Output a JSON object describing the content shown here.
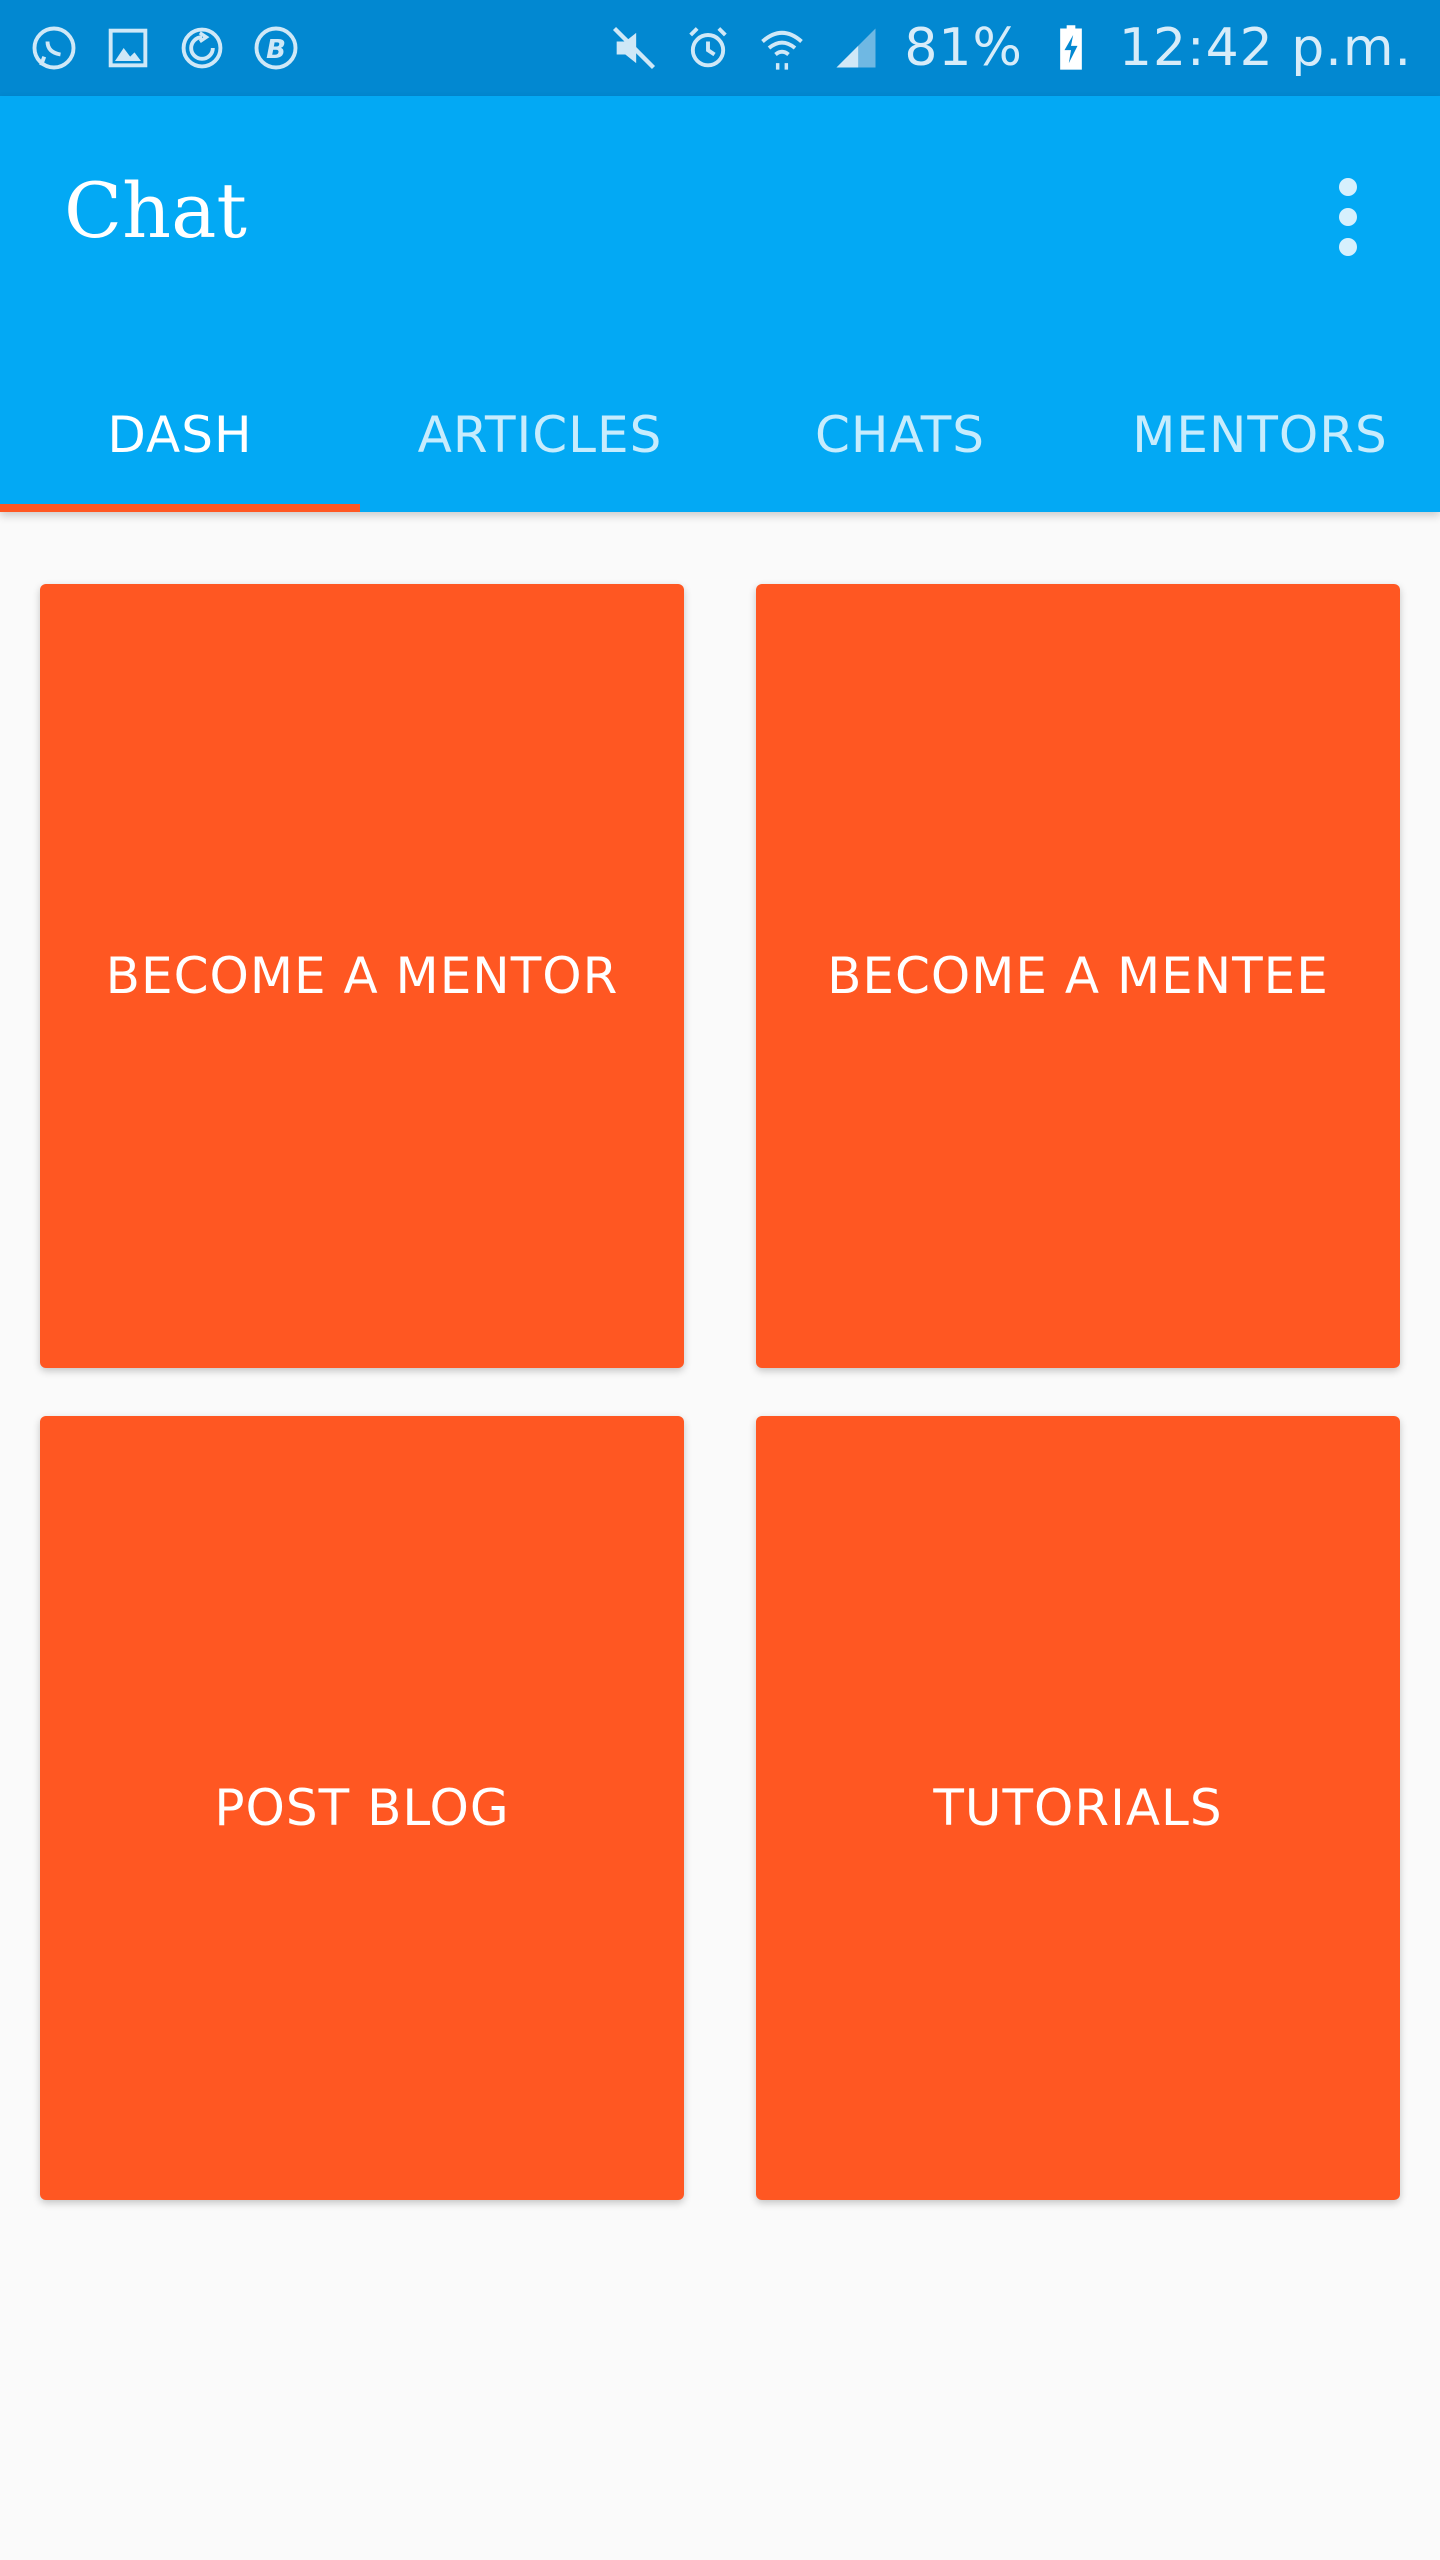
{
  "status_bar": {
    "left_icons": [
      "whatsapp-icon",
      "gallery-icon",
      "sync-icon",
      "b-icon"
    ],
    "right_icons": [
      "mute-icon",
      "alarm-icon",
      "wifi-icon",
      "signal-icon",
      "battery-charging-icon"
    ],
    "battery_percent": "81%",
    "time": "12:42 p.m."
  },
  "app_bar": {
    "title": "Chat",
    "menu_icon": "more-vert-icon"
  },
  "tabs": [
    {
      "label": "DASH",
      "active": true
    },
    {
      "label": "ARTICLES",
      "active": false
    },
    {
      "label": "CHATS",
      "active": false
    },
    {
      "label": "MENTORS",
      "active": false
    }
  ],
  "cards": [
    {
      "label": "BECOME A MENTOR"
    },
    {
      "label": "BECOME A MENTEE"
    },
    {
      "label": "POST BLOG"
    },
    {
      "label": "TUTORIALS"
    }
  ],
  "colors": {
    "status_bar": "#0288d1",
    "app_bar": "#03a9f4",
    "accent": "#ff5722",
    "background": "#fafafa"
  }
}
